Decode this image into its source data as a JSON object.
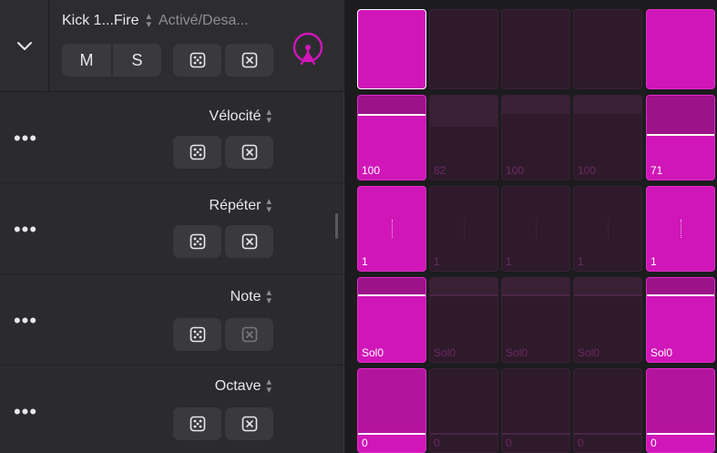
{
  "track": {
    "name": "Kick 1...Fire",
    "mode": "Activé/Desa...",
    "mute_label": "M",
    "solo_label": "S",
    "accent": "#d016b8"
  },
  "rows": [
    {
      "label": "Vélocité"
    },
    {
      "label": "Répéter"
    },
    {
      "label": "Note"
    },
    {
      "label": "Octave"
    }
  ],
  "more_label": "•••",
  "grid": {
    "velocity": [
      "100",
      "82",
      "100",
      "100",
      "71"
    ],
    "repeat": [
      "1",
      "1",
      "1",
      "1",
      "1"
    ],
    "note": [
      "Sol0",
      "Sol0",
      "Sol0",
      "Sol0",
      "Sol0"
    ],
    "octave": [
      "0",
      "0",
      "0",
      "0",
      "0"
    ]
  }
}
